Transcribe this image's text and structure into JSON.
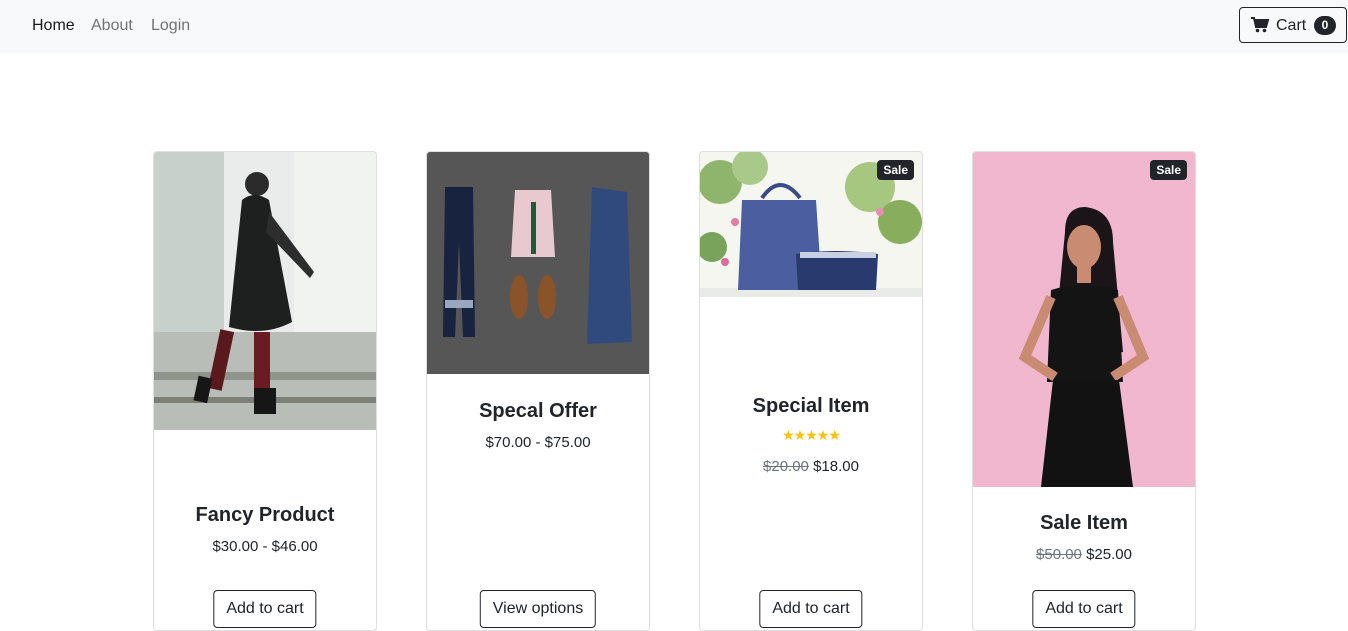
{
  "nav": {
    "links": [
      {
        "label": "Home"
      },
      {
        "label": "About"
      },
      {
        "label": "Login"
      }
    ],
    "cart": {
      "label": "Cart",
      "count": "0",
      "icon": "cart-icon"
    }
  },
  "products": [
    {
      "name": "Fancy Product",
      "price": "$30.00 - $46.00",
      "button": "Add to cart",
      "image": "woman-in-black-coat-photo"
    },
    {
      "name": "Specal Offer",
      "price": "$70.00 - $75.00",
      "button": "View options",
      "image": "outfit-flatlay-photo"
    },
    {
      "name": "Special Item",
      "badge": "Sale",
      "rating": 5,
      "old_price": "$20.00",
      "price": "$18.00",
      "button": "Add to cart",
      "image": "blue-handbags-photo"
    },
    {
      "name": "Sale Item",
      "badge": "Sale",
      "old_price": "$50.00",
      "price": "$25.00",
      "button": "Add to cart",
      "image": "woman-in-black-jumpsuit-photo"
    }
  ],
  "colors": {
    "navbar_bg": "#f8f9fa",
    "dark": "#212529",
    "star": "#ffc107"
  }
}
